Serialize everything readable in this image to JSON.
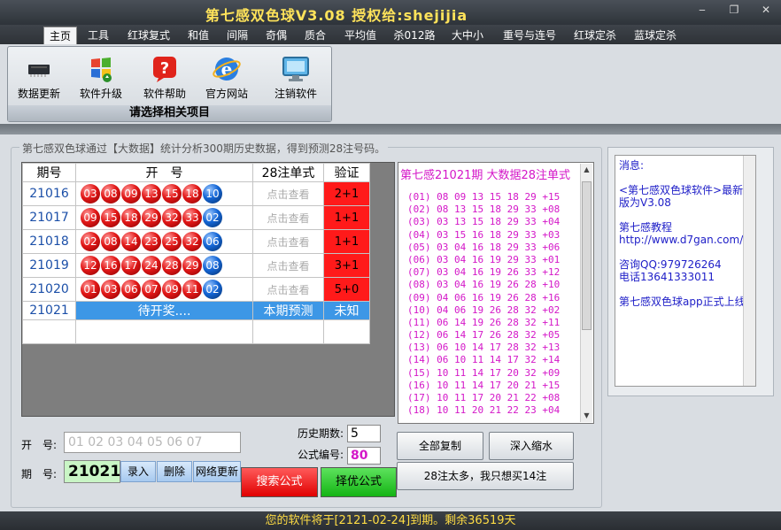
{
  "app": {
    "title": "第七感双色球V3.08  授权给:shejijia",
    "window_controls": [
      "‒",
      "❐",
      "✕"
    ]
  },
  "menu": {
    "tabs": [
      "主页",
      "工具",
      "红球复式",
      "和值",
      "间隔",
      "奇偶",
      "质合",
      "平均值",
      "杀012路",
      "大中小",
      "重号与连号",
      "红球定杀",
      "蓝球定杀"
    ],
    "active": "主页"
  },
  "ribbon": {
    "buttons": [
      {
        "label": "数据更新",
        "icon": "chip-icon"
      },
      {
        "label": "软件升级",
        "icon": "windows-update-icon"
      },
      {
        "label": "软件帮助",
        "icon": "help-icon"
      },
      {
        "label": "官方网站",
        "icon": "browser-icon"
      },
      {
        "label": "注销软件",
        "icon": "monitor-icon"
      }
    ],
    "caption": "请选择相关项目"
  },
  "group": {
    "label": "第七感双色球通过【大数据】统计分析300期历史数据，得到预测28注号码。"
  },
  "grid": {
    "headers": [
      "期号",
      "开　号",
      "28注单式",
      "验证"
    ],
    "rows": [
      {
        "period": "21016",
        "red": [
          "03",
          "08",
          "09",
          "13",
          "15",
          "18"
        ],
        "blue": "10",
        "view": "点击查看",
        "verify": "2+1"
      },
      {
        "period": "21017",
        "red": [
          "09",
          "15",
          "18",
          "29",
          "32",
          "33"
        ],
        "blue": "02",
        "view": "点击查看",
        "verify": "1+1"
      },
      {
        "period": "21018",
        "red": [
          "02",
          "08",
          "14",
          "23",
          "25",
          "32"
        ],
        "blue": "06",
        "view": "点击查看",
        "verify": "1+1"
      },
      {
        "period": "21019",
        "red": [
          "12",
          "16",
          "17",
          "24",
          "28",
          "29"
        ],
        "blue": "08",
        "view": "点击查看",
        "verify": "3+1"
      },
      {
        "period": "21020",
        "red": [
          "01",
          "03",
          "06",
          "07",
          "09",
          "11"
        ],
        "blue": "02",
        "view": "点击查看",
        "verify": "5+0"
      }
    ],
    "pending": {
      "period": "21021",
      "status": "待开奖....",
      "forecast": "本期预测",
      "verify": "未知"
    }
  },
  "predictions": {
    "header": "第七感21021期 大数据28注单式",
    "rows": [
      "(01) 08 09 13 15 18 29 +15",
      "(02) 08 13 15 18 29 33 +08",
      "(03) 03 13 15 18 29 33 +04",
      "(04) 03 15 16 18 29 33 +03",
      "(05) 03 04 16 18 29 33 +06",
      "(06) 03 04 16 19 29 33 +01",
      "(07) 03 04 16 19 26 33 +12",
      "(08) 03 04 16 19 26 28 +10",
      "(09) 04 06 16 19 26 28 +16",
      "(10) 04 06 19 26 28 32 +02",
      "(11) 06 14 19 26 28 32 +11",
      "(12) 06 14 17 26 28 32 +05",
      "(13) 06 10 14 17 28 32 +13",
      "(14) 06 10 11 14 17 32 +14",
      "(15) 10 11 14 17 20 32 +09",
      "(16) 10 11 14 17 20 21 +15",
      "(17) 10 11 17 20 21 22 +08",
      "(18) 10 11 20 21 22 23 +04"
    ]
  },
  "message": {
    "lines": [
      "消息:",
      "",
      "<第七感双色球软件>最新版为V3.08",
      "",
      "第七感教程",
      "http://www.d7gan.com/",
      "",
      "咨询QQ:979726264",
      "电话13641333011",
      "",
      "第七感双色球app正式上线"
    ]
  },
  "form": {
    "open_label": "开　号:",
    "numbers_placeholder": "01 02 03 04 05 06 07",
    "period_label": "期　号:",
    "period_value": "21021",
    "record_btn": "录入",
    "delete_btn": "删除",
    "net_update_btn": "网络更新",
    "history_label": "历史期数:",
    "history_value": "5",
    "formula_label": "公式编号:",
    "formula_value": "80",
    "search_btn": "搜索公式",
    "optimize_btn": "择优公式",
    "copy_all_btn": "全部复制",
    "shrink_btn": "深入缩水",
    "buy14_btn": "28注太多，我只想买14注"
  },
  "status": {
    "text": "您的软件将于[2121-02-24]到期。剩余36519天"
  },
  "colors": {
    "title_yellow": "#ffe35a",
    "prediction_magenta": "#d417c8",
    "verify_red": "#ff1a1a",
    "pending_blue": "#3d97e6",
    "message_blue": "#2020c8"
  }
}
